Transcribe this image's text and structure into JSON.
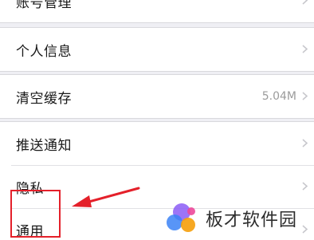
{
  "settings": {
    "groups": [
      {
        "items": [
          {
            "label": "账号管理",
            "value": ""
          }
        ]
      },
      {
        "items": [
          {
            "label": "个人信息",
            "value": ""
          }
        ]
      },
      {
        "items": [
          {
            "label": "清空缓存",
            "value": "5.04M"
          }
        ]
      },
      {
        "items": [
          {
            "label": "推送通知",
            "value": ""
          },
          {
            "label": "隐私",
            "value": ""
          },
          {
            "label": "通用",
            "value": ""
          }
        ]
      }
    ]
  },
  "annotation": {
    "highlight_color": "#e4202a"
  },
  "watermark": {
    "text": "板才软件园"
  },
  "icons": {
    "row_chevron": "chevron-right-icon"
  }
}
